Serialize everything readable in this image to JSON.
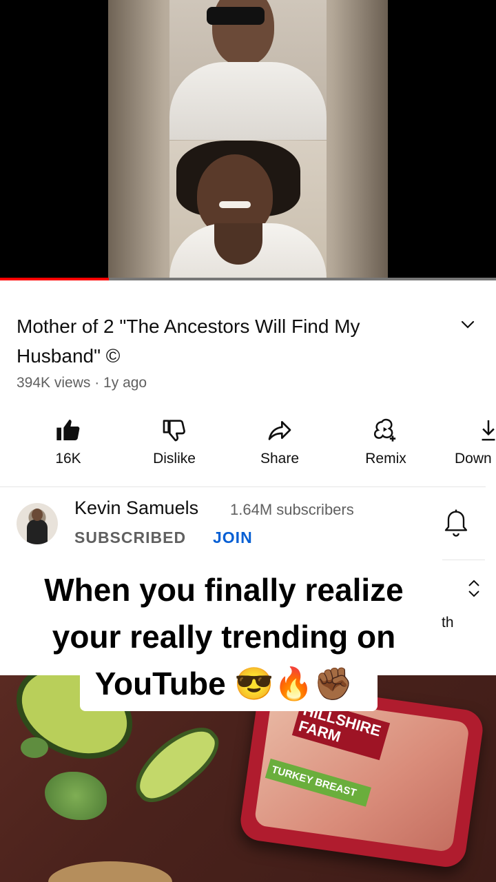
{
  "video": {
    "progress_fraction": 0.22
  },
  "details": {
    "title": "Mother of 2 \"The Ancestors Will Find My Husband\" ©",
    "meta": "394K views · 1y ago"
  },
  "actions": [
    {
      "label": "16K",
      "icon": "thumbs-up-filled-icon"
    },
    {
      "label": "Dislike",
      "icon": "thumbs-down-icon"
    },
    {
      "label": "Share",
      "icon": "share-arrow-icon"
    },
    {
      "label": "Remix",
      "icon": "remix-icon"
    },
    {
      "label": "Down",
      "icon": "download-icon"
    }
  ],
  "channel": {
    "name": "Kevin Samuels",
    "subscribers": "1.64M subscribers",
    "subscribed_label": "SUBSCRIBED",
    "join_label": "JOIN"
  },
  "comments": {
    "partial_text": "th"
  },
  "caption": {
    "line1": "When you finally realize",
    "line2": "your really trending on",
    "line3": "YouTube 😎🔥✊🏾"
  },
  "ad": {
    "brand_text": "HILLSHIRE FARM",
    "product_text": "TURKEY BREAST"
  },
  "colors": {
    "accent_red": "#ff0000",
    "link_blue": "#065fd4",
    "secondary_text": "#606060"
  }
}
